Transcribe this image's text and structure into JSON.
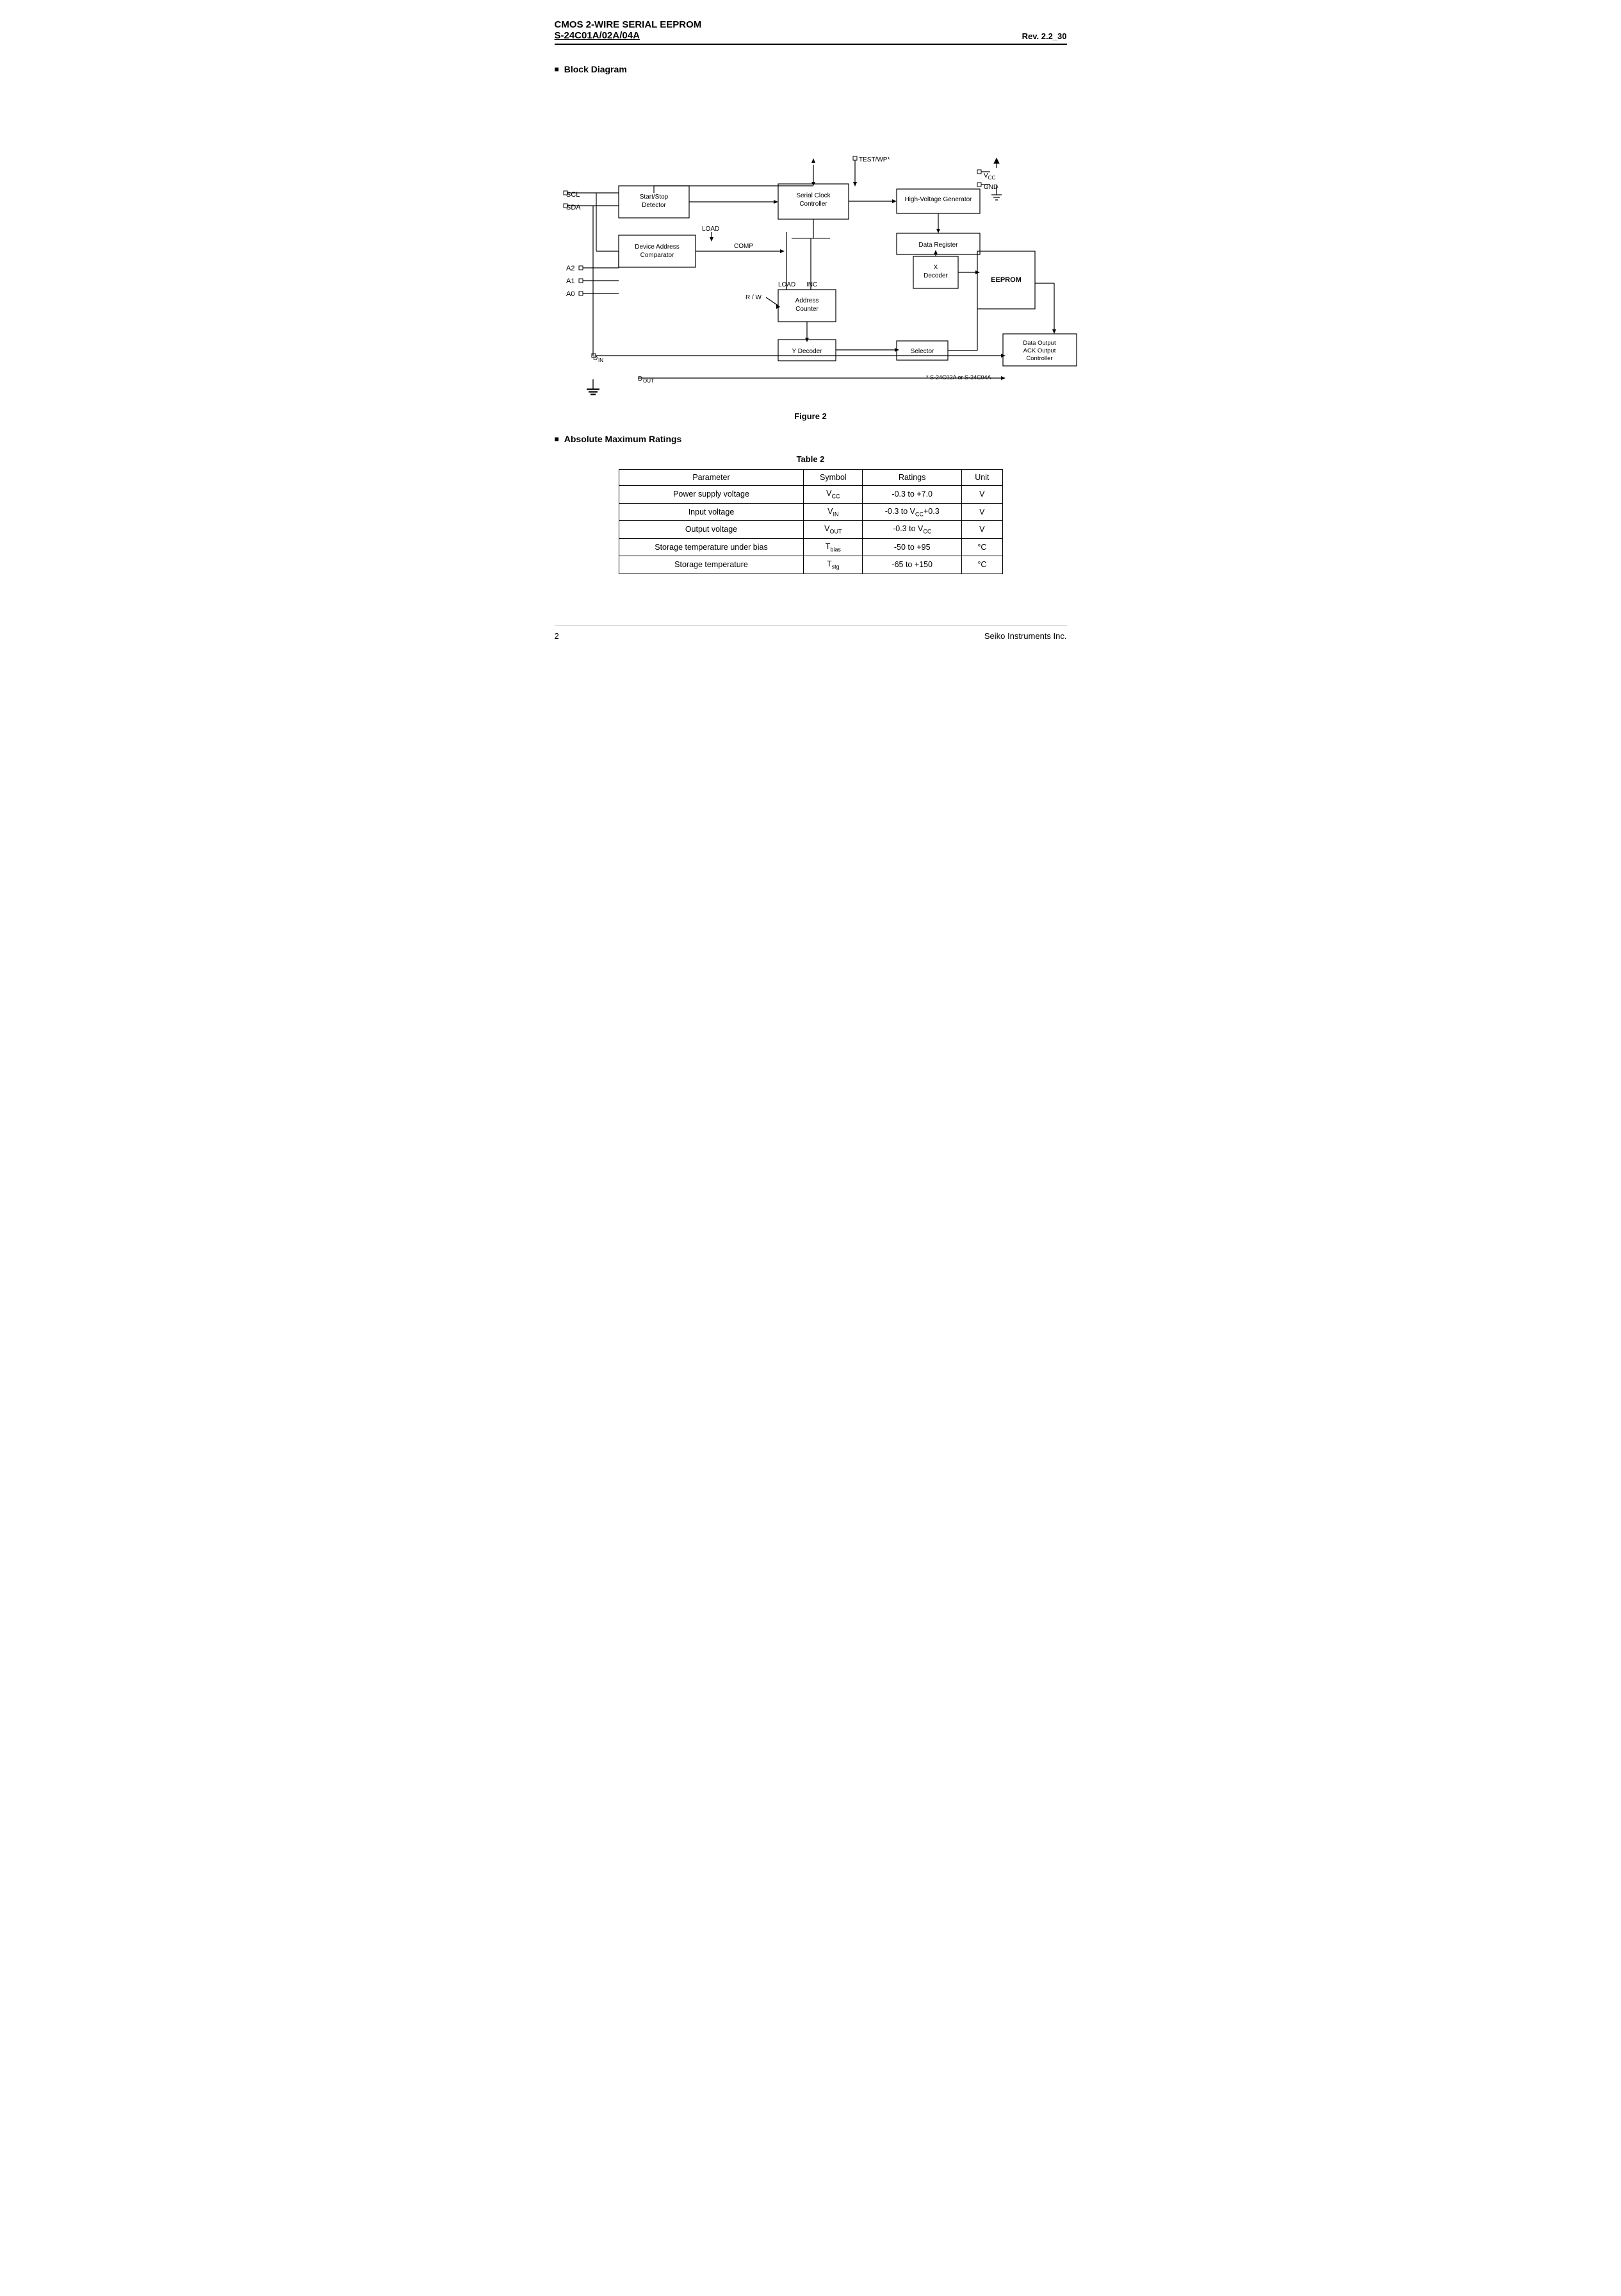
{
  "header": {
    "line1": "CMOS 2-WIRE SERIAL  EEPROM",
    "line2": "S-24C01A/02A/04A",
    "rev": "Rev. 2.2_30"
  },
  "sections": {
    "block_diagram": {
      "heading": "Block Diagram",
      "figure_caption": "Figure 2",
      "footnote": "*   S-24C02A or S-24C04A"
    },
    "ratings": {
      "heading": "Absolute Maximum Ratings",
      "table_caption": "Table  2",
      "columns": [
        "Parameter",
        "Symbol",
        "Ratings",
        "Unit"
      ],
      "rows": [
        [
          "Power supply voltage",
          "V_CC",
          "-0.3 to +7.0",
          "V"
        ],
        [
          "Input voltage",
          "V_IN",
          "-0.3 to V_CC+0.3",
          "V"
        ],
        [
          "Output voltage",
          "V_OUT",
          "-0.3 to V_CC",
          "V"
        ],
        [
          "Storage temperature under bias",
          "T_bias",
          "-50 to +95",
          "°C"
        ],
        [
          "Storage temperature",
          "T_stg",
          "-65 to +150",
          "°C"
        ]
      ]
    }
  },
  "footer": {
    "page": "2",
    "company": "Seiko Instruments Inc."
  }
}
